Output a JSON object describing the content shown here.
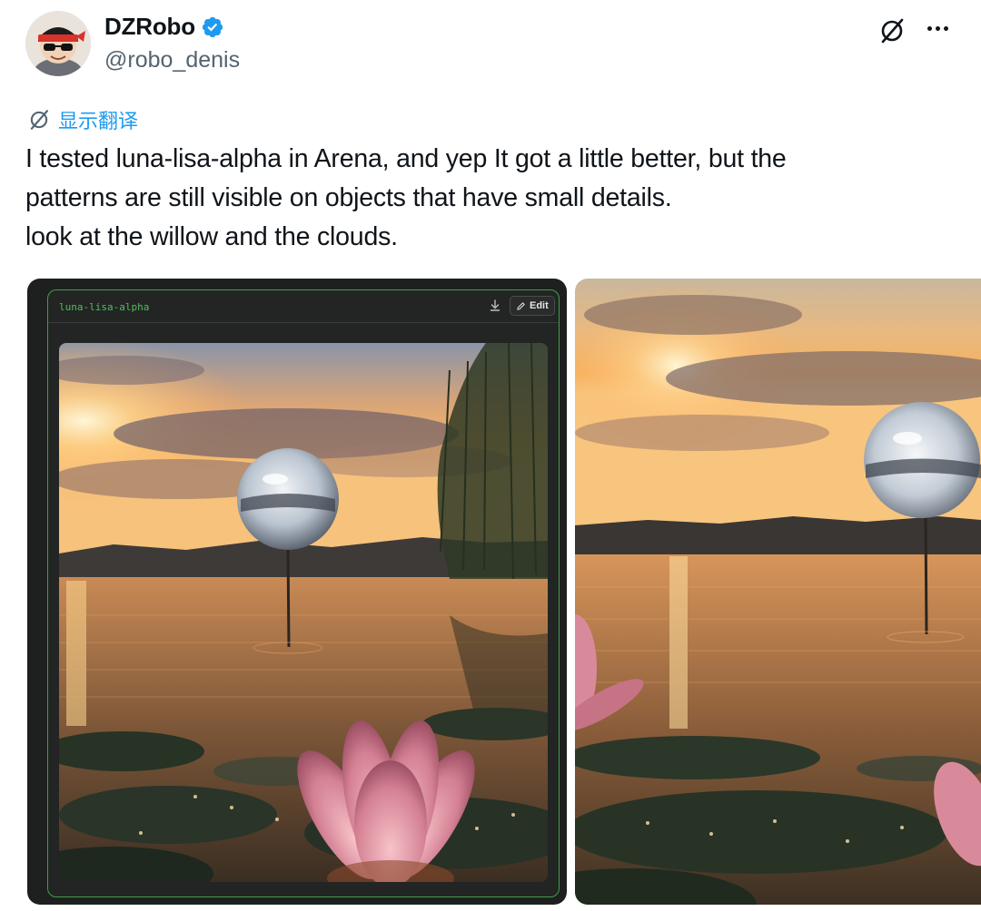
{
  "author": {
    "name": "DZRobo",
    "handle": "@robo_denis",
    "verified": true
  },
  "actions": {
    "grok_icon": "grok-icon",
    "more_icon": "more-dots-icon"
  },
  "translate": {
    "label": "显示翻译",
    "icon": "grok-icon"
  },
  "tweet": {
    "lines": [
      "I tested luna-lisa-alpha in Arena, and yep It got a little better, but the",
      "patterns are still visible on objects that have small details.",
      "look at the willow and the clouds."
    ]
  },
  "media": {
    "left": {
      "model_label": "luna-lisa-alpha",
      "download_icon": "download-icon",
      "edit_label": "Edit",
      "edit_icon": "pencil-icon"
    }
  },
  "colors": {
    "accent": "#1d9bf0",
    "text": "#0f1419",
    "muted": "#536471",
    "arena_green": "#4cc15a"
  }
}
